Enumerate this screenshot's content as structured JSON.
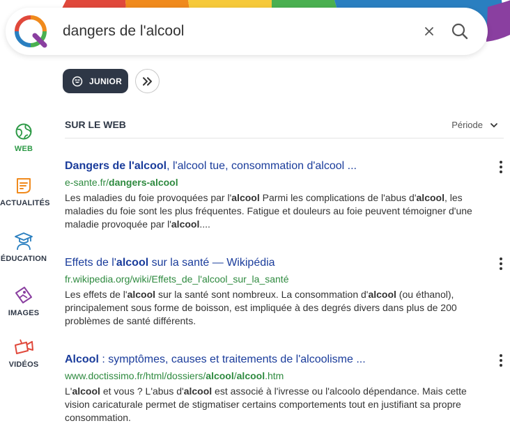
{
  "search": {
    "query": "dangers de l'alcool"
  },
  "filters": {
    "junior_label": "JUNIOR"
  },
  "nav": {
    "web": "WEB",
    "news": "ACTUALITÉS",
    "education": "ÉDUCATION",
    "images": "IMAGES",
    "videos": "VIDÉOS"
  },
  "section": {
    "title": "SUR LE WEB",
    "period_label": "Période"
  },
  "results": [
    {
      "title": [
        {
          "t": "Dangers de l'alcool",
          "b": true
        },
        {
          "t": ", l'alcool tue, consommation d'alcool ...",
          "b": false
        }
      ],
      "url": [
        {
          "t": "e-sante.fr/",
          "b": false
        },
        {
          "t": "dangers-alcool",
          "b": true
        }
      ],
      "snippet": [
        {
          "t": "Les maladies du foie provoquées par l'",
          "b": false
        },
        {
          "t": "alcool",
          "b": true
        },
        {
          "t": " Parmi les complications de l'abus d'",
          "b": false
        },
        {
          "t": "alcool",
          "b": true
        },
        {
          "t": ", les maladies du foie sont les plus fréquentes. Fatigue et douleurs au foie peuvent témoigner d'une maladie provoquée par l'",
          "b": false
        },
        {
          "t": "alcool",
          "b": true
        },
        {
          "t": "....",
          "b": false
        }
      ]
    },
    {
      "title": [
        {
          "t": "Effets de l'",
          "b": false
        },
        {
          "t": "alcool",
          "b": true
        },
        {
          "t": " sur la santé — Wikipédia",
          "b": false
        }
      ],
      "url": [
        {
          "t": "fr.wikipedia.org/wiki/Effets_de_l'alcool_sur_la_santé",
          "b": false
        }
      ],
      "snippet": [
        {
          "t": "Les effets de l'",
          "b": false
        },
        {
          "t": "alcool",
          "b": true
        },
        {
          "t": " sur la santé sont nombreux. La consommation d'",
          "b": false
        },
        {
          "t": "alcool",
          "b": true
        },
        {
          "t": " (ou éthanol), principalement sous forme de boisson, est impliquée à des degrés divers dans plus de 200 problèmes de santé différents.",
          "b": false
        }
      ]
    },
    {
      "title": [
        {
          "t": "Alcool",
          "b": true
        },
        {
          "t": " : symptômes, causes et traitements de l'alcoolisme ...",
          "b": false
        }
      ],
      "url": [
        {
          "t": "www.doctissimo.fr/html/dossiers/",
          "b": false
        },
        {
          "t": "alcool",
          "b": true
        },
        {
          "t": "/",
          "b": false
        },
        {
          "t": "alcool",
          "b": true
        },
        {
          "t": ".htm",
          "b": false
        }
      ],
      "snippet": [
        {
          "t": "L'",
          "b": false
        },
        {
          "t": "alcool",
          "b": true
        },
        {
          "t": " et vous ? L'abus d'",
          "b": false
        },
        {
          "t": "alcool",
          "b": true
        },
        {
          "t": " est associé à l'ivresse ou l'alcoolo dépendance. Mais cette vision caricaturale permet de stigmatiser certains comportements tout en justifiant sa propre consommation.",
          "b": false
        }
      ]
    }
  ],
  "colors": {
    "brand_dark": "#2e3746",
    "link_blue": "#1a3c9b",
    "url_green": "#2e8a3f",
    "active_green": "#2e9a47",
    "icon_red": "#e0483b",
    "icon_orange": "#f08a1d",
    "icon_blue": "#2a7fc0",
    "icon_purple": "#8a3fa0"
  },
  "icons": {
    "logo": "qwant-logo",
    "clear": "close-icon",
    "search": "search-icon",
    "junior": "smiley-icon",
    "more": "double-chevron-right-icon",
    "web": "globe-icon",
    "news": "news-icon",
    "education": "graduate-icon",
    "images": "image-icon",
    "videos": "video-camera-icon",
    "period": "chevron-down-icon",
    "menu": "kebab-menu-icon"
  }
}
